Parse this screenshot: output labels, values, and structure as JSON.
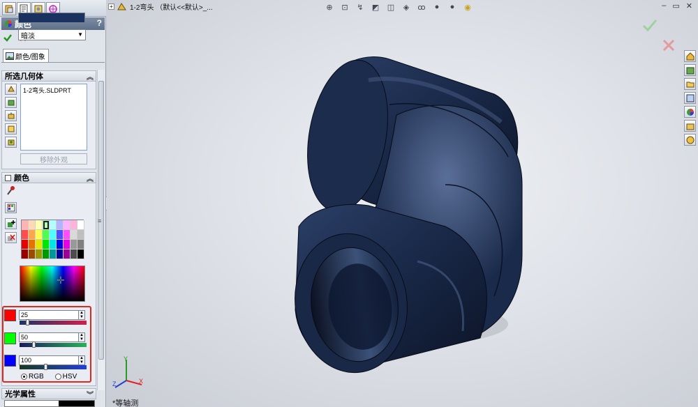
{
  "panel": {
    "title": "颜色",
    "help": "?",
    "tabs": [
      "feature-manager",
      "property-manager",
      "configuration-manager",
      "dimxpert-manager"
    ],
    "subtab_label": "颜色/图象",
    "selected_geometry": {
      "header": "所选几何体",
      "items": [
        "1-2弯头.SLDPRT"
      ],
      "remove_button": "移除外观"
    },
    "color": {
      "header": "颜色",
      "current_color": "#19325f",
      "mode": "暗淡",
      "palette": [
        [
          "#ffb3b3",
          "#ffd9b3",
          "#ffffb3",
          "#b3ffb3",
          "#b3ffff",
          "#b3b3ff",
          "#ffb3ff",
          "#ffb3d9",
          "#ffffff"
        ],
        [
          "#ff4d4d",
          "#ffa64d",
          "#ffff4d",
          "#4dff4d",
          "#4dffff",
          "#4d4dff",
          "#ff4dff",
          "#d9d9d9",
          "#bfbfbf"
        ],
        [
          "#e60000",
          "#e67300",
          "#e6e600",
          "#00e600",
          "#00e6e6",
          "#0000e6",
          "#e600e6",
          "#999999",
          "#808080"
        ],
        [
          "#990000",
          "#994d00",
          "#999900",
          "#009900",
          "#009999",
          "#000099",
          "#990099",
          "#4d4d4d",
          "#000000"
        ]
      ],
      "channels": [
        {
          "name": "red",
          "value": "25",
          "level": 0.1
        },
        {
          "name": "green",
          "value": "50",
          "level": 0.2
        },
        {
          "name": "blue",
          "value": "100",
          "level": 0.39
        }
      ],
      "modes": [
        "RGB",
        "HSV"
      ],
      "selected_mode": "RGB"
    },
    "optical": {
      "header": "光学属性"
    }
  },
  "viewport": {
    "breadcrumb": "1-2弯头 （默认<<默认>_...",
    "view_label": "*等轴测",
    "model_color": "#1a2a4a"
  }
}
